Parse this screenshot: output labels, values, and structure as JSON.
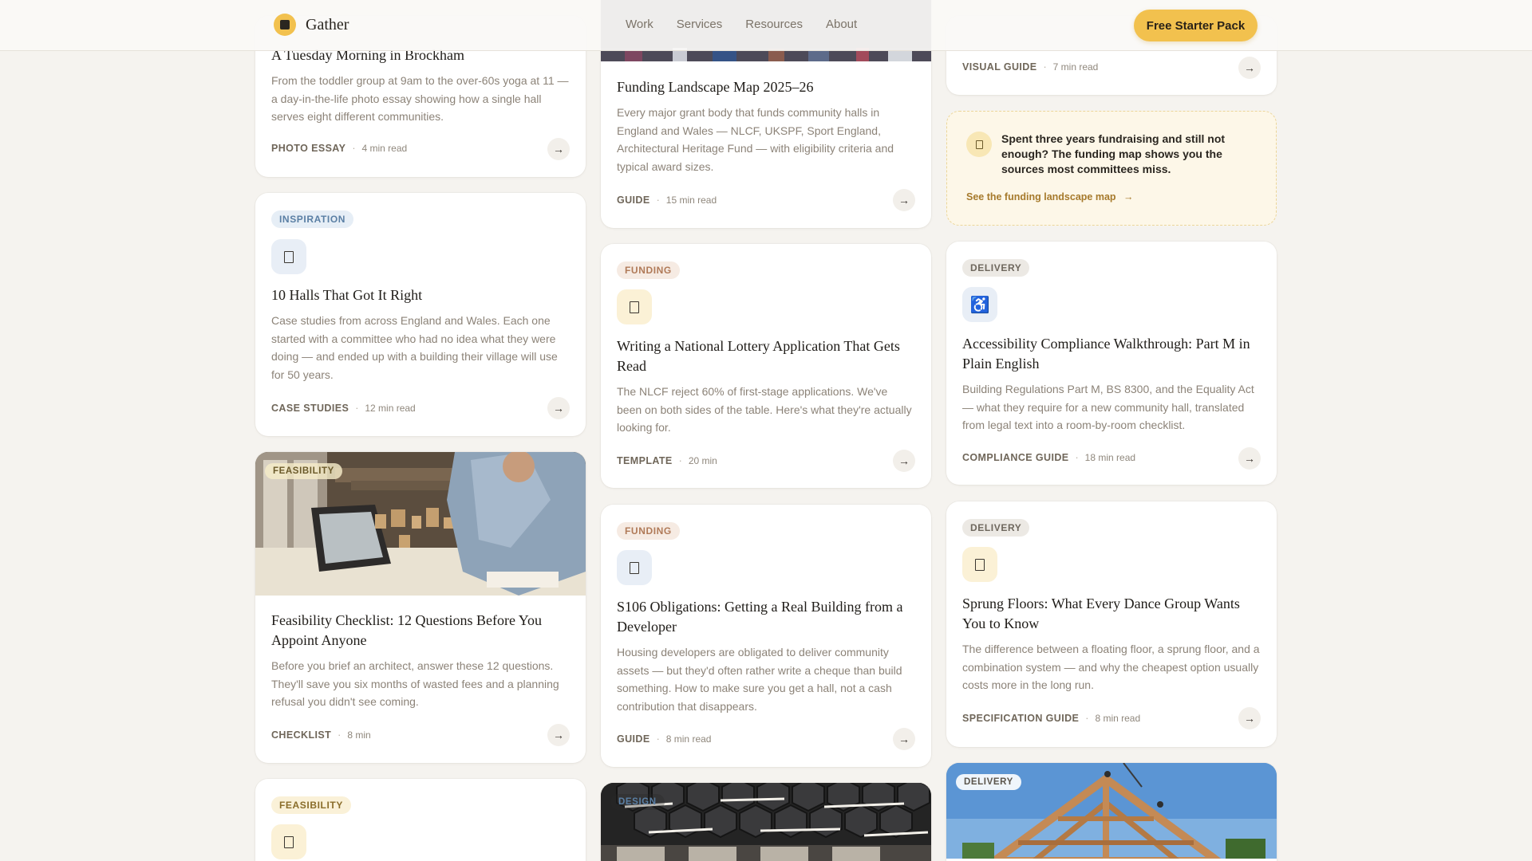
{
  "header": {
    "brand": "Gather",
    "nav": [
      "Work",
      "Services",
      "Resources",
      "About"
    ],
    "cta": "Free Starter Pack"
  },
  "colors": {
    "accent": "#f2c14e",
    "background": "#f5f3ef",
    "card": "#ffffff"
  },
  "cards": {
    "brockham": {
      "title": "A Tuesday Morning in Brockham",
      "desc": "From the toddler group at 9am to the over-60s yoga at 11 — a day-in-the-life photo essay showing how a single hall serves eight different communities.",
      "type": "Photo Essay",
      "time": "4 min read"
    },
    "halls": {
      "tag": "Inspiration",
      "icon": "document-icon",
      "title": "10 Halls That Got It Right",
      "desc": "Case studies from across England and Wales. Each one started with a committee who had no idea what they were doing — and ended up with a building their village will use for 50 years.",
      "type": "Case Studies",
      "time": "12 min read"
    },
    "feasibility": {
      "tag": "Feasibility",
      "title": "Feasibility Checklist: 12 Questions Before You Appoint Anyone",
      "desc": "Before you brief an architect, answer these 12 questions. They'll save you six months of wasted fees and a planning refusal you didn't see coming.",
      "type": "Checklist",
      "time": "8 min"
    },
    "feasibility2": {
      "tag": "Feasibility",
      "icon": "document-icon"
    },
    "funding_map": {
      "title": "Funding Landscape Map 2025–26",
      "desc": "Every major grant body that funds community halls in England and Wales — NLCF, UKSPF, Sport England, Architectural Heritage Fund — with eligibility criteria and typical award sizes.",
      "type": "Guide",
      "time": "15 min read"
    },
    "lottery": {
      "tag": "Funding",
      "icon": "document-icon",
      "title": "Writing a National Lottery Application That Gets Read",
      "desc": "The NLCF reject 60% of first-stage applications. We've been on both sides of the table. Here's what they're actually looking for.",
      "type": "Template",
      "time": "20 min"
    },
    "s106": {
      "tag": "Funding",
      "icon": "document-icon",
      "title": "S106 Obligations: Getting a Real Building from a Developer",
      "desc": "Housing developers are obligated to deliver community assets — but they'd often rather write a cheque than build something. How to make sure you get a hall, not a cash contribution that disappears.",
      "type": "Guide",
      "time": "8 min read"
    },
    "design": {
      "tag": "Design"
    },
    "visual": {
      "type": "Visual Guide",
      "time": "7 min read"
    },
    "promo": {
      "text": "Spent three years fundraising and still not enough? The funding map shows you the sources most committees miss.",
      "link": "See the funding landscape map",
      "arrow": "→"
    },
    "access": {
      "tag": "Delivery",
      "icon": "♿",
      "title": "Accessibility Compliance Walkthrough: Part M in Plain English",
      "desc": "Building Regulations Part M, BS 8300, and the Equality Act — what they require for a new community hall, translated from legal text into a room-by-room checklist.",
      "type": "Compliance Guide",
      "time": "18 min read"
    },
    "floors": {
      "tag": "Delivery",
      "icon": "document-icon",
      "title": "Sprung Floors: What Every Dance Group Wants You to Know",
      "desc": "The difference between a floating floor, a sprung floor, and a combination system — and why the cheapest option usually costs more in the long run.",
      "type": "Specification Guide",
      "time": "8 min read"
    },
    "delivery_img": {
      "tag": "Delivery"
    }
  },
  "arrow": "→"
}
